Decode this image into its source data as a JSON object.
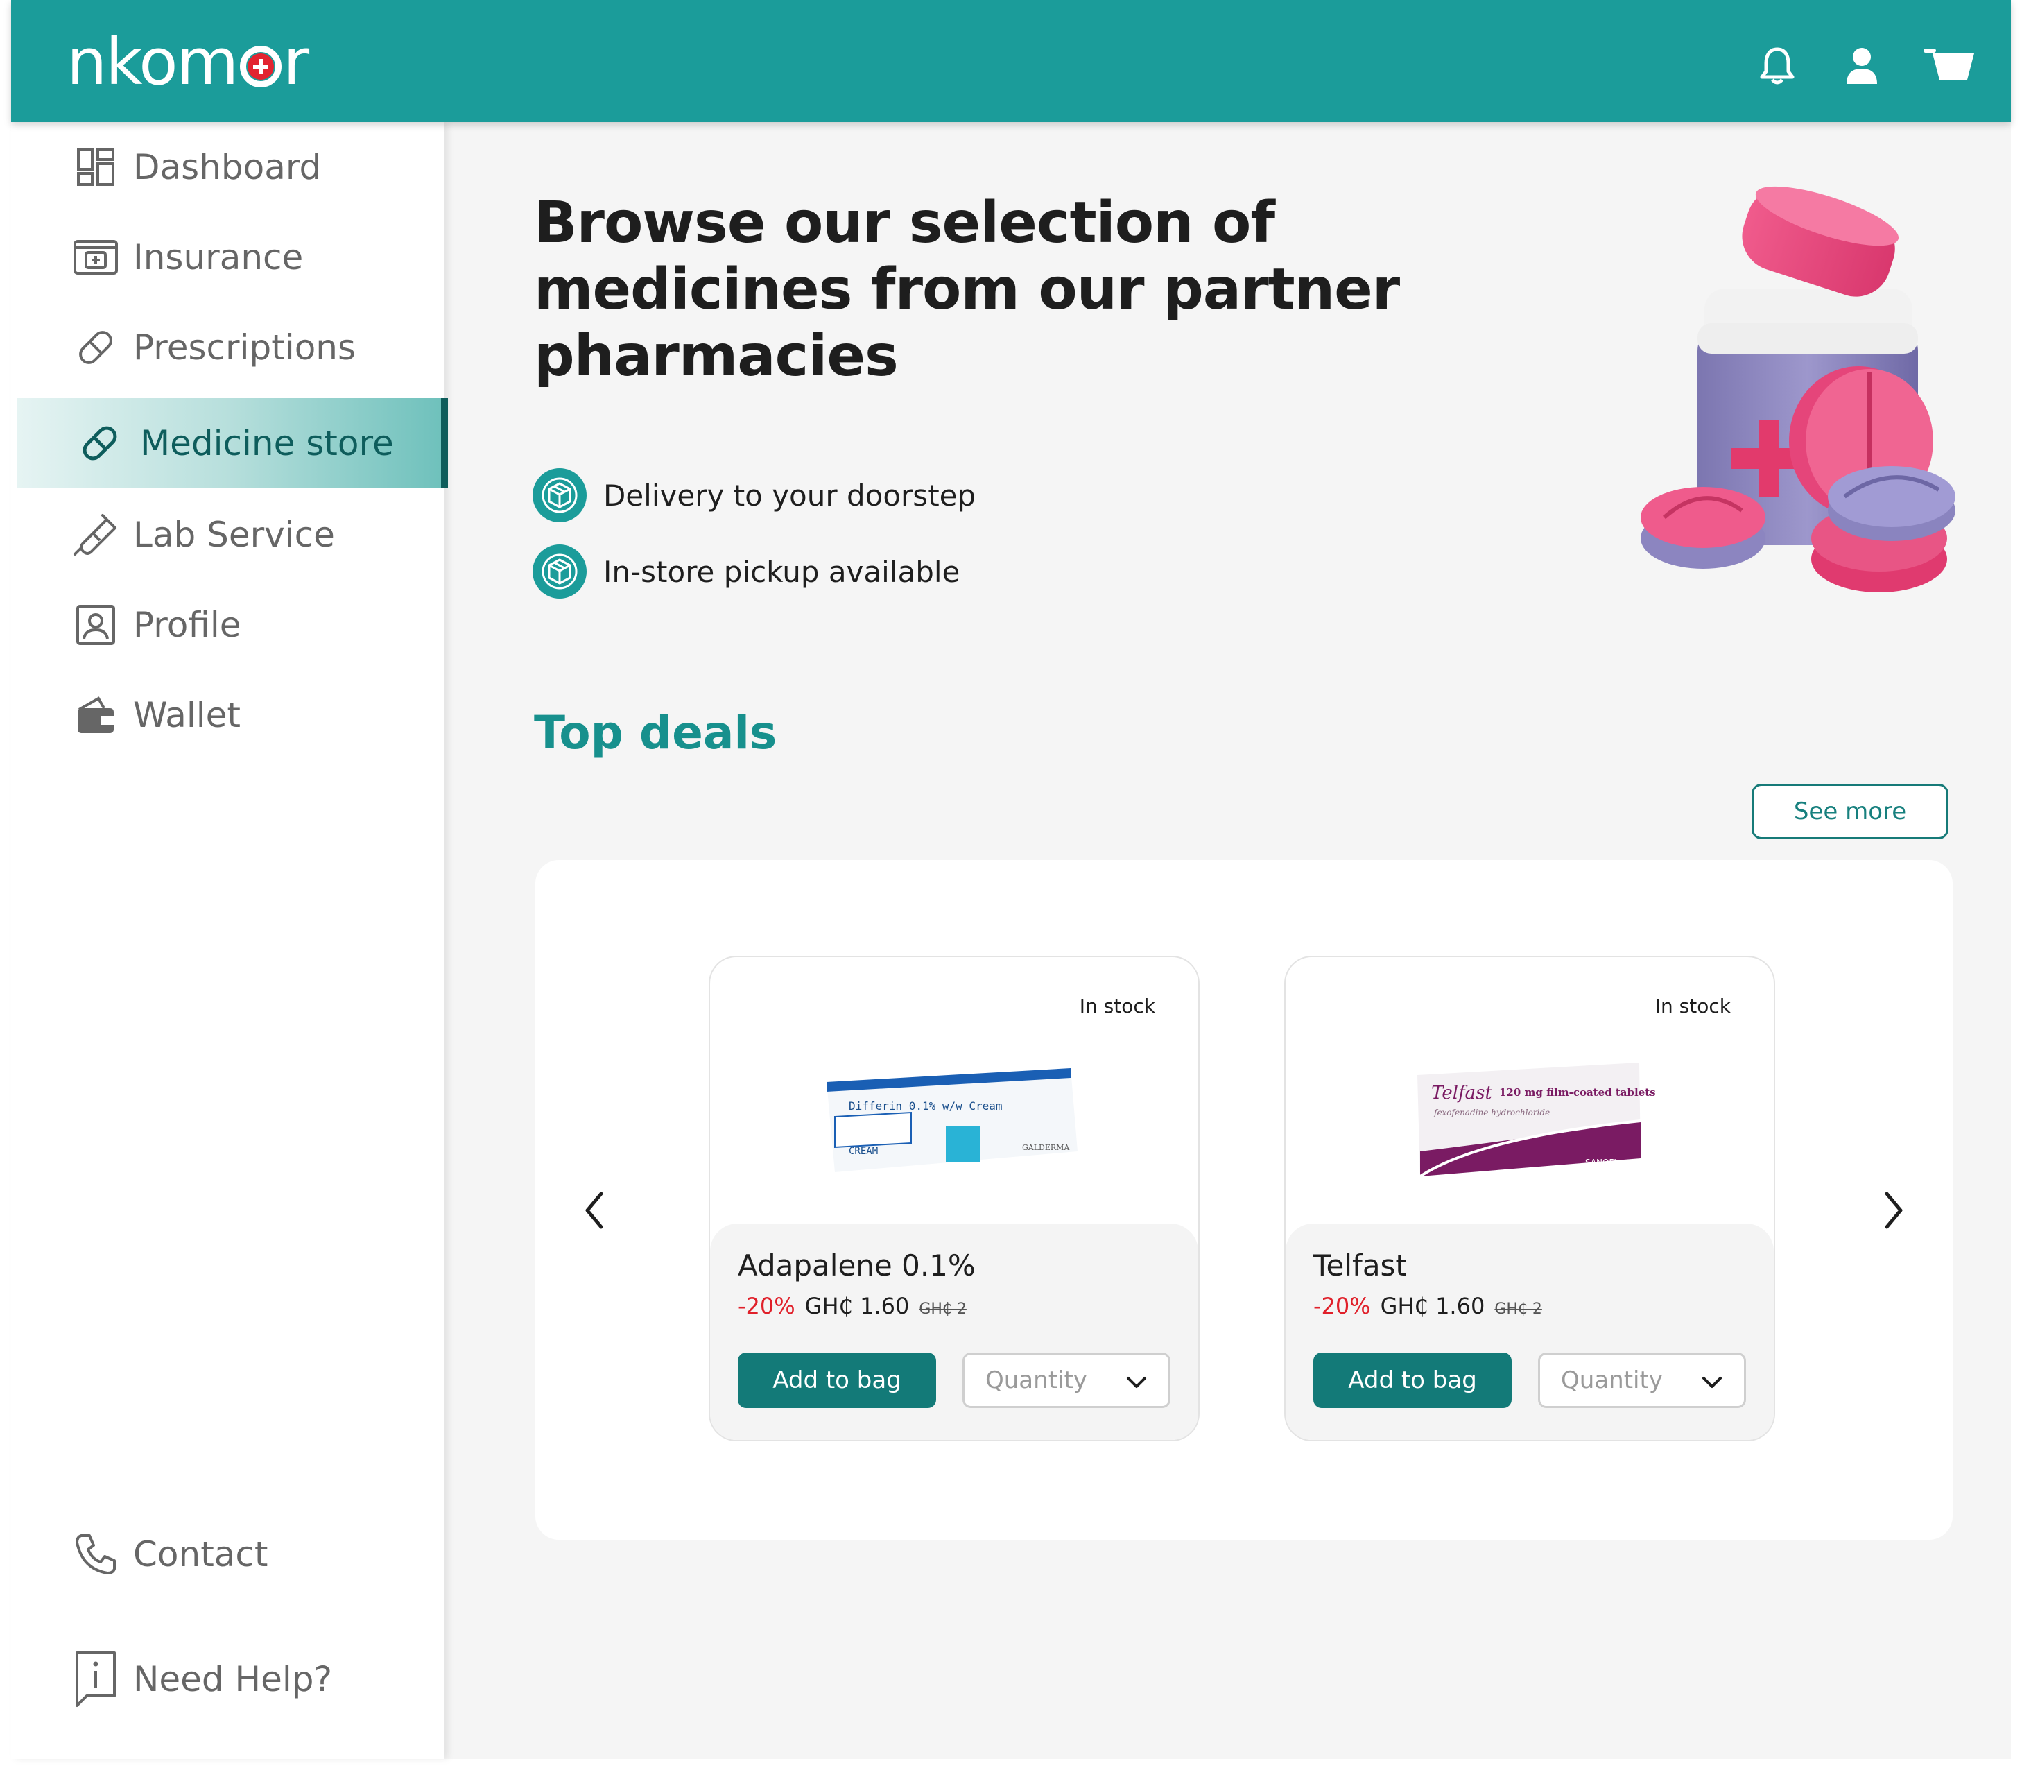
{
  "app": {
    "logo_text_left": "nkom",
    "logo_text_right": "r",
    "brand_color": "#1b9c9a",
    "accent_dark": "#137a78",
    "discount_color": "#e0202a"
  },
  "header": {
    "icons": [
      "bell-icon",
      "user-icon",
      "cart-icon"
    ]
  },
  "sidebar": {
    "items": [
      {
        "label": "Dashboard",
        "icon": "dashboard-icon",
        "active": false
      },
      {
        "label": "Insurance",
        "icon": "insurance-card-icon",
        "active": false
      },
      {
        "label": "Prescriptions",
        "icon": "pill-icon",
        "active": false
      },
      {
        "label": "Medicine store",
        "icon": "pill-icon",
        "active": true
      },
      {
        "label": "Lab Service",
        "icon": "test-tube-icon",
        "active": false
      },
      {
        "label": "Profile",
        "icon": "profile-icon",
        "active": false
      },
      {
        "label": "Wallet",
        "icon": "wallet-icon",
        "active": false
      }
    ],
    "footer": [
      {
        "label": "Contact",
        "icon": "phone-icon"
      },
      {
        "label": "Need Help?",
        "icon": "info-icon"
      }
    ]
  },
  "hero": {
    "title_line1": "Browse our selection of",
    "title_line2": "medicines from our partner",
    "title_line3": "pharmacies",
    "features": [
      {
        "text": "Delivery to your doorstep",
        "icon": "box-icon"
      },
      {
        "text": "In-store pickup available",
        "icon": "box-icon"
      }
    ]
  },
  "deals": {
    "title": "Top deals",
    "see_more": "See more",
    "products": [
      {
        "stock": "In stock",
        "name": "Adapalene 0.1%",
        "discount": "-20%",
        "price": "GH₵ 1.60",
        "old_price": "GH₵ 2",
        "add_label": "Add to bag",
        "quantity_placeholder": "Quantity",
        "pack_text1": "Differin 0.1% w/w Cream",
        "pack_text2": "CREAM",
        "pack_brand": "GALDERMA"
      },
      {
        "stock": "In stock",
        "name": "Telfast",
        "discount": "-20%",
        "price": "GH₵ 1.60",
        "old_price": "GH₵ 2",
        "add_label": "Add to bag",
        "quantity_placeholder": "Quantity",
        "pack_text1": "Telfast",
        "pack_text2": "120 mg film-coated tablets",
        "pack_sub": "fexofenadine hydrochloride",
        "pack_brand": "SANOFI"
      }
    ]
  }
}
